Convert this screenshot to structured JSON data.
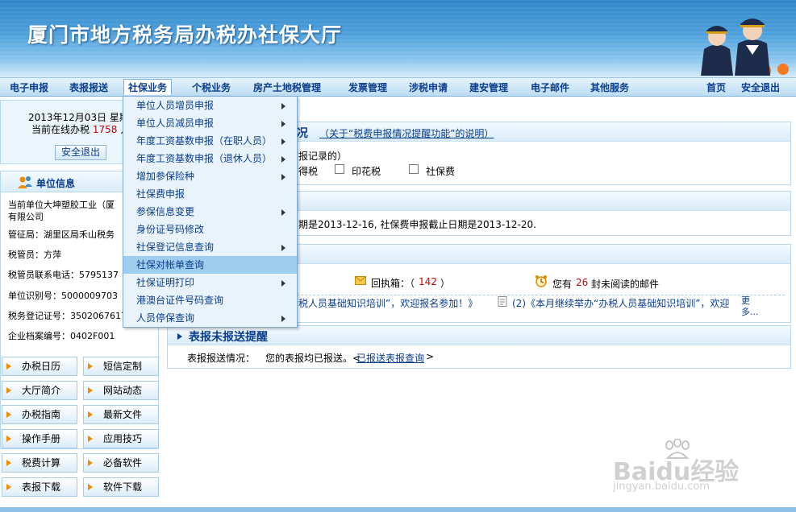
{
  "banner": {
    "title": "厦门市地方税务局办税办社保大厅",
    "officers_image": "officers-saluting"
  },
  "nav": {
    "items": [
      "电子申报",
      "表报报送",
      "社保业务",
      "个税业务",
      "房产土地税管理",
      "发票管理",
      "涉税申请",
      "建安管理",
      "电子邮件",
      "其他服务"
    ],
    "right": [
      "首页",
      "安全退出"
    ],
    "active_index": 2
  },
  "sidebar": {
    "date_line": "2013年12月03日  星期",
    "online_label": "当前在线办税",
    "online_count": "1758",
    "online_suffix": "人",
    "logout": "安全退出",
    "unit_title": "单位信息",
    "unit_lines": [
      "当前单位大坤塑胶工业（厦",
      "有限公司",
      "管征局：湖里区局禾山税务",
      "税管员：方萍",
      "税管员联系电话：5795137",
      "单位识别号：5000009703",
      "税务登记证号：3502067617",
      "企业档案编号：0402F001"
    ],
    "quick_links": [
      "办税日历",
      "短信定制",
      "大厅简介",
      "网站动态",
      "办税指南",
      "最新文件",
      "操作手册",
      "应用技巧",
      "税费计算",
      "必备软件",
      "表报下载",
      "软件下载"
    ]
  },
  "main": {
    "panel1": {
      "title_partial": "况",
      "title_link": "（关于“税费申报情况提醒功能”的说明）",
      "line1": "报记录的）",
      "checkbox_labels": [
        "得税",
        "印花税",
        "社保费"
      ]
    },
    "panel2": {
      "text": "期是2013-12-16, 社保费申报截止日期是2013-12-20."
    },
    "panel3": {
      "receipt_label": "回执箱：（",
      "receipt_count": "142",
      "receipt_close": "）",
      "mail_prefix": "您有",
      "mail_count": "26",
      "mail_suffix": "封未阅读的邮件",
      "notice1": "税人员基础知识培训”，欢迎报名参加！》",
      "notice2": "(2)《本月继续举办“办税人员基础知识培训”，欢迎",
      "more": "更多..."
    },
    "panel4": {
      "title": "表报未报送提醒",
      "status_label": "表报报送情况：",
      "status_text": "您的表报均已报送。<",
      "status_link": "已报送表报查询",
      "status_close": ">"
    }
  },
  "menu": {
    "items": [
      {
        "label": "单位人员增员申报",
        "has_sub": true
      },
      {
        "label": "单位人员减员申报",
        "has_sub": true
      },
      {
        "label": "年度工资基数申报（在职人员）",
        "has_sub": true
      },
      {
        "label": "年度工资基数申报（退休人员）",
        "has_sub": true
      },
      {
        "label": "增加参保险种",
        "has_sub": true
      },
      {
        "label": "社保费申报",
        "has_sub": false
      },
      {
        "label": "参保信息变更",
        "has_sub": true
      },
      {
        "label": "身份证号码修改",
        "has_sub": false
      },
      {
        "label": "社保登记信息查询",
        "has_sub": true
      },
      {
        "label": "社保对帐单查询",
        "has_sub": false
      },
      {
        "label": "社保证明打印",
        "has_sub": true
      },
      {
        "label": "港澳台证件号码查询",
        "has_sub": false
      },
      {
        "label": "人员停保查询",
        "has_sub": true
      }
    ],
    "highlight_index": 9
  },
  "watermark": {
    "brand": "Baidu经验",
    "url": "jingyan.baidu.com"
  },
  "colors": {
    "nav_text": "#0a3d8f",
    "highlight": "#9fcdf0",
    "accent_red": "#cc0000",
    "arrow_orange": "#f08a00"
  }
}
